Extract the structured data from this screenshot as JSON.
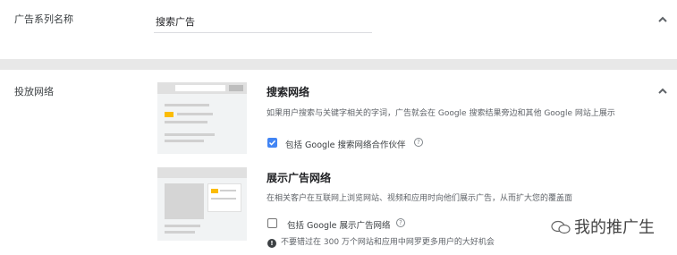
{
  "campaign_name_section": {
    "label": "广告系列名称",
    "input_value": "搜索广告"
  },
  "networks_section": {
    "label": "投放网络",
    "search": {
      "title": "搜索网络",
      "description": "如果用户搜索与关键字相关的字词，广告就会在 Google 搜索结果旁边和其他 Google 网站上展示",
      "checkbox_label": "包括 Google 搜索网络合作伙伴",
      "checked": true
    },
    "display": {
      "title": "展示广告网络",
      "description": "在相关客户在互联网上浏览网站、视频和应用时向他们展示广告，从而扩大您的覆盖面",
      "checkbox_label": "包括 Google 展示广告网络",
      "checked": false,
      "warning": "不要错过在 300 万个网站和应用中网罗更多用户的大好机会"
    }
  },
  "watermark": "我的推广生"
}
